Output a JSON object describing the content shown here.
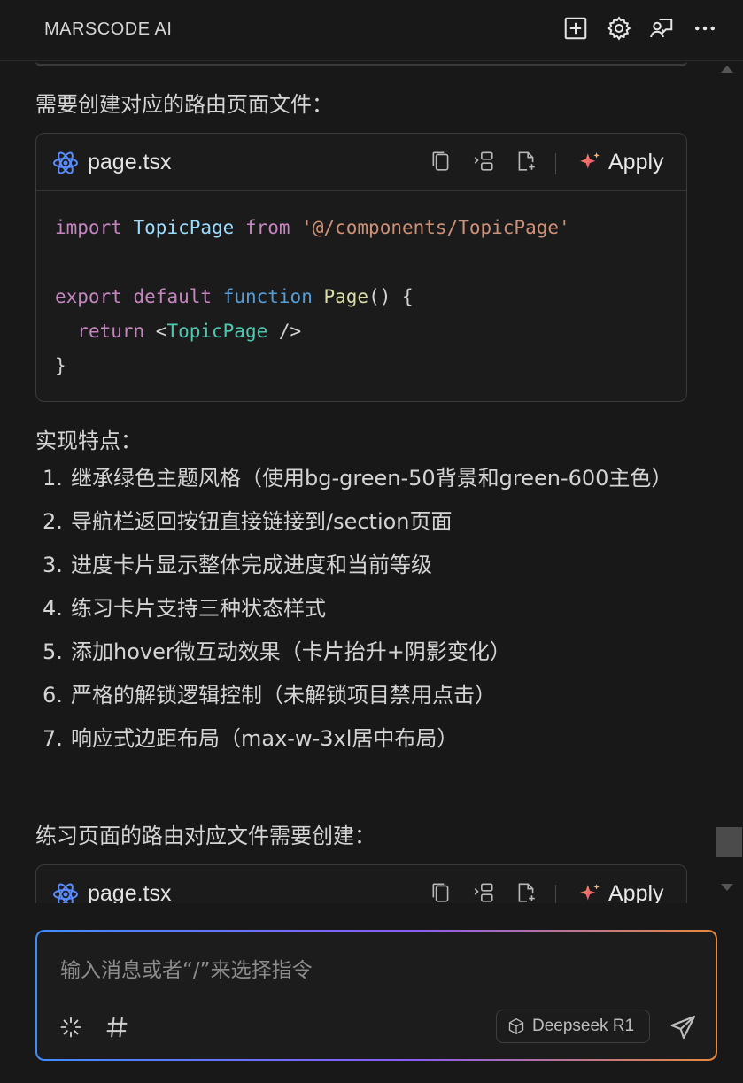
{
  "header": {
    "title": "MARSCODE AI",
    "icons": [
      "new-chat-icon",
      "gear-icon",
      "feedback-icon",
      "more-icon"
    ]
  },
  "content": {
    "intro_text": "需要创建对应的路由页面文件：",
    "code_block_1": {
      "filename": "page.tsx",
      "apply_label": "Apply",
      "lines": [
        [
          {
            "t": "import",
            "c": "kw"
          },
          {
            "t": " ",
            "c": "pn"
          },
          {
            "t": "TopicPage",
            "c": "id"
          },
          {
            "t": " ",
            "c": "pn"
          },
          {
            "t": "from",
            "c": "kw"
          },
          {
            "t": " ",
            "c": "pn"
          },
          {
            "t": "'@/components/TopicPage'",
            "c": "str"
          }
        ],
        [],
        [
          {
            "t": "export",
            "c": "kw"
          },
          {
            "t": " ",
            "c": "pn"
          },
          {
            "t": "default",
            "c": "kw"
          },
          {
            "t": " ",
            "c": "pn"
          },
          {
            "t": "function",
            "c": "kw2"
          },
          {
            "t": " ",
            "c": "pn"
          },
          {
            "t": "Page",
            "c": "fn"
          },
          {
            "t": "() {",
            "c": "pn"
          }
        ],
        [
          {
            "t": "  ",
            "c": "pn"
          },
          {
            "t": "return",
            "c": "kw"
          },
          {
            "t": " <",
            "c": "pn"
          },
          {
            "t": "TopicPage",
            "c": "tag"
          },
          {
            "t": " />",
            "c": "pn"
          }
        ],
        [
          {
            "t": "}",
            "c": "pn"
          }
        ]
      ]
    },
    "features_heading": "实现特点：",
    "features": [
      {
        "num": "1.",
        "text": "继承绿色主题风格（使用bg-green-50背景和green-600主色）"
      },
      {
        "num": "2.",
        "text": "导航栏返回按钮直接链接到/section页面"
      },
      {
        "num": "3.",
        "text": "进度卡片显示整体完成进度和当前等级"
      },
      {
        "num": "4.",
        "text": "练习卡片支持三种状态样式"
      },
      {
        "num": "5.",
        "text": "添加hover微互动效果（卡片抬升+阴影变化）"
      },
      {
        "num": "6.",
        "text": "严格的解锁逻辑控制（未解锁项目禁用点击）"
      },
      {
        "num": "7.",
        "text": "响应式边距布局（max-w-3xl居中布局）"
      }
    ],
    "practice_text": "练习页面的路由对应文件需要创建：",
    "code_block_2": {
      "filename": "page.tsx",
      "apply_label": "Apply"
    }
  },
  "input": {
    "placeholder": "输入消息或者“/”来选择指令",
    "model_label": "Deepseek R1"
  }
}
